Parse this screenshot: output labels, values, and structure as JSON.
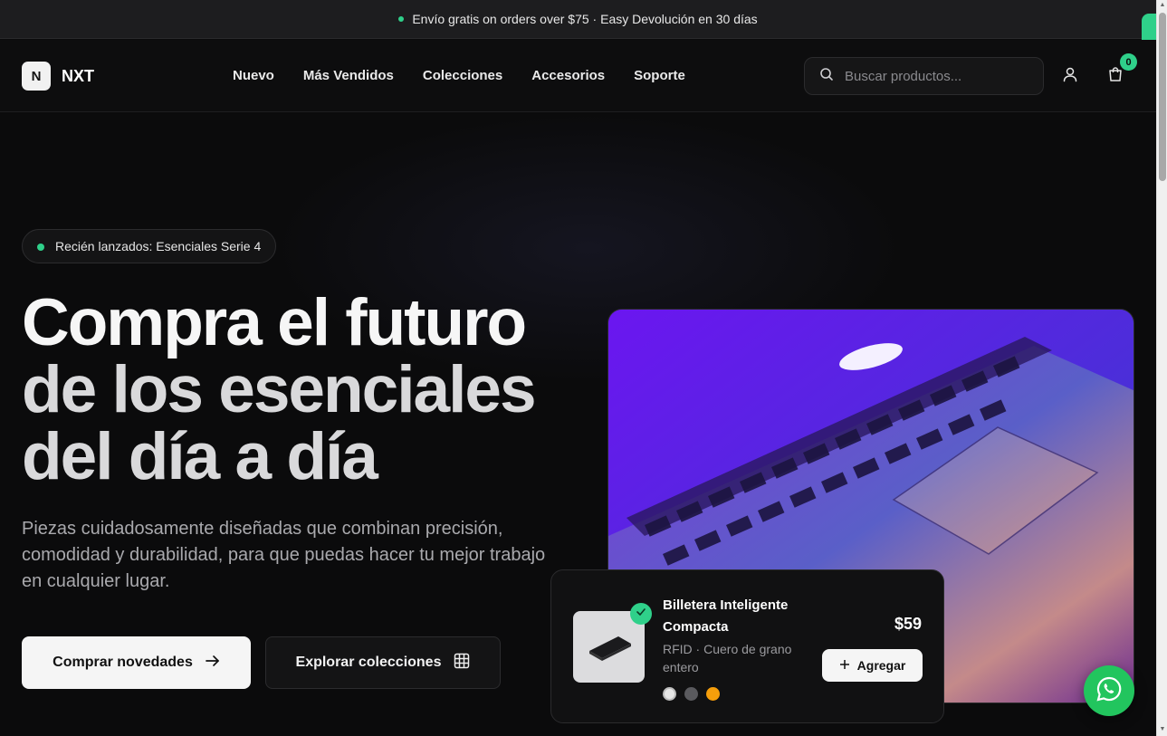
{
  "announcement": {
    "text": "Envío gratis on orders over $75 · Easy Devolución en 30 días"
  },
  "brand": {
    "logo_letter": "N",
    "name": "NXT"
  },
  "nav": {
    "items": [
      {
        "label": "Nuevo"
      },
      {
        "label": "Más Vendidos"
      },
      {
        "label": "Colecciones"
      },
      {
        "label": "Accesorios"
      },
      {
        "label": "Soporte"
      }
    ]
  },
  "search": {
    "placeholder": "Buscar productos...",
    "value": ""
  },
  "cart": {
    "count": "0"
  },
  "hero": {
    "badge": "Recién lanzados: Esenciales Serie 4",
    "headline_lines": [
      "Compra el futuro",
      "de los esenciales",
      "del día a día"
    ],
    "subtext": "Piezas cuidadosamente diseñadas que combinan precisión, comodidad y durabilidad, para que puedas hacer tu mejor trabajo en cualquier lugar.",
    "primary_cta": "Comprar novedades",
    "secondary_cta": "Explorar colecciones"
  },
  "product_card": {
    "title": "Billetera Inteligente Compacta",
    "price": "$59",
    "description": "RFID · Cuero de grano entero",
    "add_label": "Agregar",
    "swatches": [
      "#e6e6e6",
      "#5a5a5e",
      "#f59e0b"
    ]
  },
  "colors": {
    "accent": "#2fd08a",
    "whatsapp": "#22c55e",
    "background": "#0b0b0c"
  },
  "icons": [
    "search-icon",
    "user-icon",
    "cart-icon",
    "arrow-right-icon",
    "grid-icon",
    "check-icon",
    "plus-icon",
    "whatsapp-icon"
  ]
}
